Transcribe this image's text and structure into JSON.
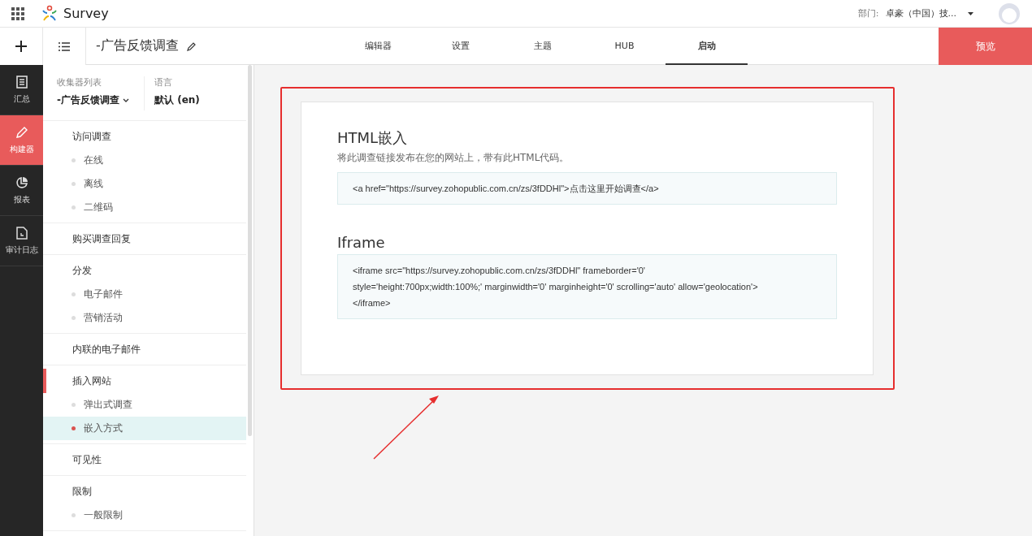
{
  "top_bar": {
    "app_name": "Survey",
    "department_label": "部门:",
    "department_value": "卓豪（中国）技..."
  },
  "toolbar": {
    "survey_title": "-广告反馈调查",
    "tabs": [
      {
        "label": "编辑器",
        "selected": false
      },
      {
        "label": "设置",
        "selected": false
      },
      {
        "label": "主题",
        "selected": false
      },
      {
        "label": "HUB",
        "selected": false
      },
      {
        "label": "启动",
        "selected": true
      }
    ],
    "preview_button": "预览"
  },
  "rail": [
    {
      "label": "汇总",
      "kind": "summary",
      "selected": false
    },
    {
      "label": "构建器",
      "kind": "builder",
      "selected": true
    },
    {
      "label": "报表",
      "kind": "reports",
      "selected": false
    },
    {
      "label": "审计日志",
      "kind": "audit",
      "selected": false
    }
  ],
  "sidebar": {
    "collector_label": "收集器列表",
    "collector_value": "-广告反馈调查",
    "language_label": "语言",
    "language_value": "默认 (en)",
    "sections": [
      {
        "label": "访问调查",
        "selected": false,
        "children": [
          {
            "label": "在线",
            "selected": false
          },
          {
            "label": "离线",
            "selected": false
          },
          {
            "label": "二维码",
            "selected": false
          }
        ]
      },
      {
        "label": "购买调查回复",
        "selected": false
      },
      {
        "label": "分发",
        "selected": false,
        "children": [
          {
            "label": "电子邮件",
            "selected": false
          },
          {
            "label": "营销活动",
            "selected": false
          }
        ]
      },
      {
        "label": "内联的电子邮件",
        "selected": false
      },
      {
        "label": "插入网站",
        "selected": true,
        "children": [
          {
            "label": "弹出式调查",
            "selected": false
          },
          {
            "label": "嵌入方式",
            "selected": true
          }
        ]
      },
      {
        "label": "可见性",
        "selected": false
      },
      {
        "label": "限制",
        "selected": false,
        "children": [
          {
            "label": "一般限制",
            "selected": false
          }
        ]
      }
    ]
  },
  "content": {
    "blocks": [
      {
        "title": "HTML嵌入",
        "description": "将此调查链接发布在您的网站上，带有此HTML代码。",
        "code": [
          "<a href=\"https://survey.zohopublic.com.cn/zs/3fDDHl\">点击这里开始调查</a>"
        ]
      },
      {
        "title": "Iframe",
        "code": [
          "<iframe src=\"https://survey.zohopublic.com.cn/zs/3fDDHl\" frameborder='0'",
          "style='height:700px;width:100%;' marginwidth='0' marginheight='0' scrolling='auto' allow='geolocation'>",
          "</iframe>"
        ]
      }
    ]
  }
}
